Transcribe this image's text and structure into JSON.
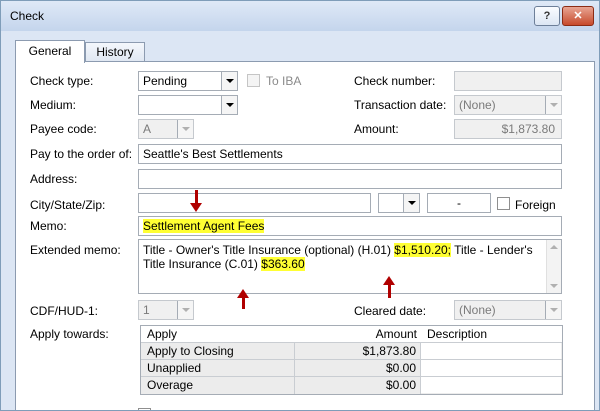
{
  "window": {
    "title": "Check",
    "help_label": "?",
    "close_label": "✕"
  },
  "tabs": [
    {
      "label": "General"
    },
    {
      "label": "History"
    }
  ],
  "fields": {
    "check_type": {
      "label": "Check type:",
      "value": "Pending"
    },
    "to_iba": {
      "label": "To IBA",
      "checked": false
    },
    "check_number": {
      "label": "Check number:",
      "value": ""
    },
    "medium": {
      "label": "Medium:",
      "value": ""
    },
    "transaction_date": {
      "label": "Transaction date:",
      "value": "(None)"
    },
    "payee_code": {
      "label": "Payee code:",
      "value": "A"
    },
    "amount": {
      "label": "Amount:",
      "value": "$1,873.80"
    },
    "pay_to": {
      "label": "Pay to the order of:",
      "value": "Seattle's Best Settlements"
    },
    "address": {
      "label": "Address:",
      "value": ""
    },
    "city_state_zip": {
      "label": "City/State/Zip:",
      "city": "",
      "state": "",
      "zip": "-"
    },
    "foreign": {
      "label": "Foreign",
      "checked": false
    },
    "memo": {
      "label": "Memo:",
      "value": "Settlement Agent Fees"
    },
    "extended_memo": {
      "label": "Extended memo:",
      "part1": "Title - Owner's Title Insurance (optional) (H.01) ",
      "hl1": "$1,510.20;",
      "part2": " Title - Lender's Title Insurance (C.01) ",
      "hl2": "$363.60"
    },
    "cdf_hud": {
      "label": "CDF/HUD-1:",
      "value": "1"
    },
    "cleared_date": {
      "label": "Cleared date:",
      "value": "(None)"
    },
    "apply_towards": {
      "label": "Apply towards:"
    }
  },
  "apply_table": {
    "columns": [
      "Apply",
      "Amount",
      "Description"
    ],
    "rows": [
      {
        "apply": "Apply to Closing",
        "amount": "$1,873.80",
        "description": ""
      },
      {
        "apply": "Unapplied",
        "amount": "$0.00",
        "description": ""
      },
      {
        "apply": "Overage",
        "amount": "$0.00",
        "description": ""
      }
    ]
  },
  "colors": {
    "highlight": "#ffff33",
    "annotation_arrow": "#b00000",
    "dialog_bg": "#dce6f4"
  }
}
